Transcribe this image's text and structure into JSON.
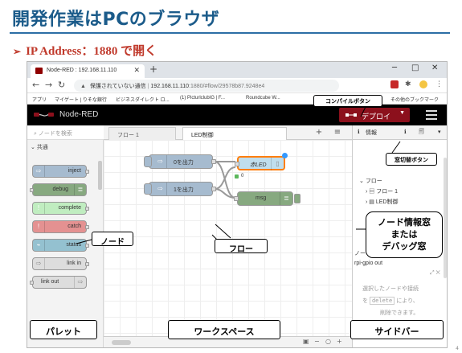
{
  "slide": {
    "title": "開発作業はPCのブラウザ",
    "bullet": "IP Address：1880 で開く",
    "page_number": "4"
  },
  "browser": {
    "tab_title": "Node-RED : 192.168.11.110",
    "url_warning": "保護されていない通信",
    "url_host": "192.168.11.110",
    "url_path": ":1880/#flow/29578b87.9248e4",
    "bookmarks": [
      "アプリ",
      "マイゲート | りそな銀行",
      "ビジネスダイレクト ロ...",
      "(1) PicturlclubIG | F...",
      "Roundcube W...",
      "その他のブックマーク"
    ]
  },
  "nodered": {
    "app_name": "Node-RED",
    "deploy_label": "デプロイ",
    "palette": {
      "search_placeholder": "ノードを検索",
      "category": "共通",
      "nodes": [
        {
          "label": "inject",
          "color": "#a6bbcf"
        },
        {
          "label": "debug",
          "color": "#87a980"
        },
        {
          "label": "complete",
          "color": "#c0edc0"
        },
        {
          "label": "catch",
          "color": "#e49191"
        },
        {
          "label": "status",
          "color": "#94c1d0"
        },
        {
          "label": "link in",
          "color": "#dddddd"
        },
        {
          "label": "link out",
          "color": "#dddddd"
        }
      ]
    },
    "workspace": {
      "tabs": [
        "フロー 1",
        "LED制御"
      ],
      "nodes": [
        {
          "label": "0を出力",
          "color": "#a6bbcf"
        },
        {
          "label": "1を出力",
          "color": "#a6bbcf"
        },
        {
          "label": "赤LED",
          "color": "#c0deed"
        },
        {
          "label": "msg",
          "color": "#87a980"
        }
      ]
    },
    "sidebar": {
      "tab_info": "情報",
      "tree_header": "フロー",
      "tree_items": [
        "フロー 1",
        "LED制御"
      ],
      "node_label": "ノー",
      "node_id": "rpi-gpio out",
      "help_line1": "選択したノードや接続",
      "help_line2_key": "delete",
      "help_line2_rest": "により、",
      "help_line3": "削除できます。"
    }
  },
  "callouts": {
    "compile_button": "コンパイルボタン",
    "window_switch": "窓切替ボタン",
    "node_info_line1": "ノード情報窓",
    "node_info_line2": "または",
    "node_info_line3": "デバッグ窓",
    "node": "ノード",
    "flow": "フロー",
    "palette": "パレット",
    "workspace": "ワークスペース",
    "sidebar": "サイドバー"
  },
  "colors": {
    "title": "#1b5b8a",
    "bullet": "#c0392b",
    "deploy": "#8c101c",
    "header": "#000000"
  }
}
